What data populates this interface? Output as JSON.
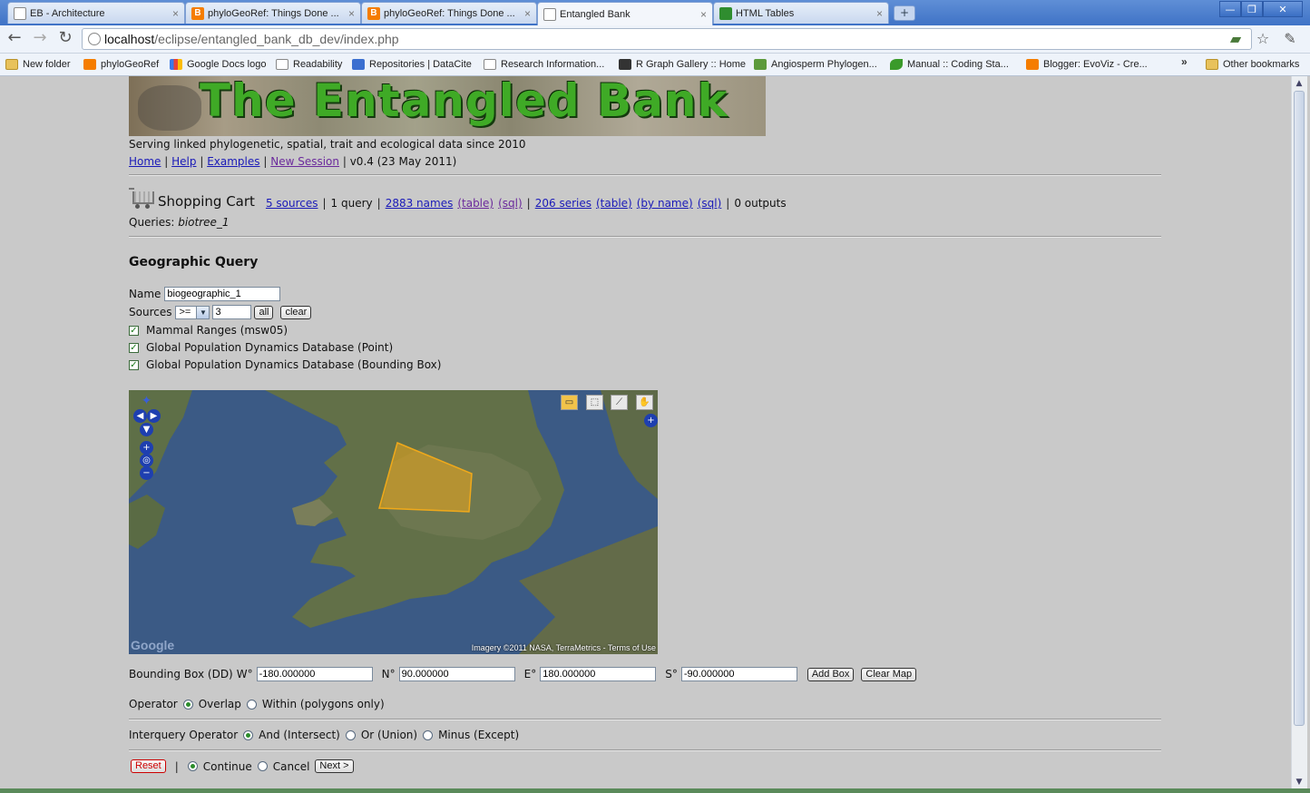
{
  "browser": {
    "tabs": [
      {
        "label": "EB - Architecture",
        "icon": "doc-icon"
      },
      {
        "label": "phyloGeoRef: Things Done ...",
        "icon": "blogger-icon"
      },
      {
        "label": "phyloGeoRef: Things Done ...",
        "icon": "blogger-icon"
      },
      {
        "label": "Entangled Bank",
        "icon": "doc-icon",
        "active": true
      },
      {
        "label": "HTML Tables",
        "icon": "html-tables-icon"
      }
    ],
    "tab_close": "×",
    "new_tab": "+",
    "window_controls": {
      "minimize": "—",
      "restore": "❐",
      "close": "✕"
    },
    "url_host": "localhost",
    "url_path": "/eclipse/entangled_bank_db_dev/index.php",
    "bookmarks": [
      "New folder",
      "phyloGeoRef",
      "Google Docs logo",
      "Readability",
      "Repositories | DataCite",
      "Research Information...",
      "R Graph Gallery :: Home",
      "Angiosperm Phylogen...",
      "Manual :: Coding Sta...",
      "Blogger: EvoViz - Cre..."
    ],
    "bookmarks_more": "»",
    "other_bookmarks": "Other bookmarks"
  },
  "header": {
    "banner_title": "The Entangled Bank",
    "tagline": "Serving linked phylogenetic, spatial, trait and ecological data since 2010",
    "nav": {
      "home": "Home",
      "help": "Help",
      "examples": "Examples",
      "new_session": "New Session",
      "version": "v0.4 (23 May 2011)"
    },
    "sep": "|"
  },
  "cart": {
    "title": "Shopping Cart",
    "sources": "5 sources",
    "query": "1 query",
    "names": "2883 names",
    "series": "206 series",
    "table": "(table)",
    "by_name": "(by name)",
    "sql": "(sql)",
    "outputs": "0 outputs",
    "queries_label": "Queries:",
    "queries_value": "biotree_1"
  },
  "geo": {
    "heading": "Geographic Query",
    "name_label": "Name",
    "name_value": "biogeographic_1",
    "sources_label": "Sources",
    "sources_op": ">=",
    "sources_value": "3",
    "all_btn": "all",
    "clear_btn": "clear",
    "datasets": [
      {
        "label": "Mammal Ranges (msw05)",
        "checked": true
      },
      {
        "label": "Global Population Dynamics Database (Point)",
        "checked": true
      },
      {
        "label": "Global Population Dynamics Database (Bounding Box)",
        "checked": true
      }
    ],
    "map_credit": "Imagery ©2011 NASA, TerraMetrics - Terms of Use",
    "map_logo": "Google",
    "bbox_label": "Bounding Box (DD)",
    "w_label": "W°",
    "w_value": "-180.000000",
    "n_label": "N°",
    "n_value": "90.000000",
    "e_label": "E°",
    "e_value": "180.000000",
    "s_label": "S°",
    "s_value": "-90.000000",
    "add_box": "Add Box",
    "clear_map": "Clear Map",
    "operator_label": "Operator",
    "operator_options": [
      "Overlap",
      "Within (polygons only)"
    ],
    "operator_selected": "Overlap",
    "interquery_label": "Interquery Operator",
    "interquery_options": [
      "And (Intersect)",
      "Or (Union)",
      "Minus (Except)"
    ],
    "interquery_selected": "And (Intersect)",
    "reset": "Reset",
    "continue": "Continue",
    "cancel": "Cancel",
    "next": "Next >"
  },
  "colors": {
    "page_bg": "#c9c9c9",
    "link": "#1a1ab8",
    "visited": "#6b2a9c",
    "banner_title": "#3faa26",
    "selection_polygon": "#f0a91a"
  }
}
